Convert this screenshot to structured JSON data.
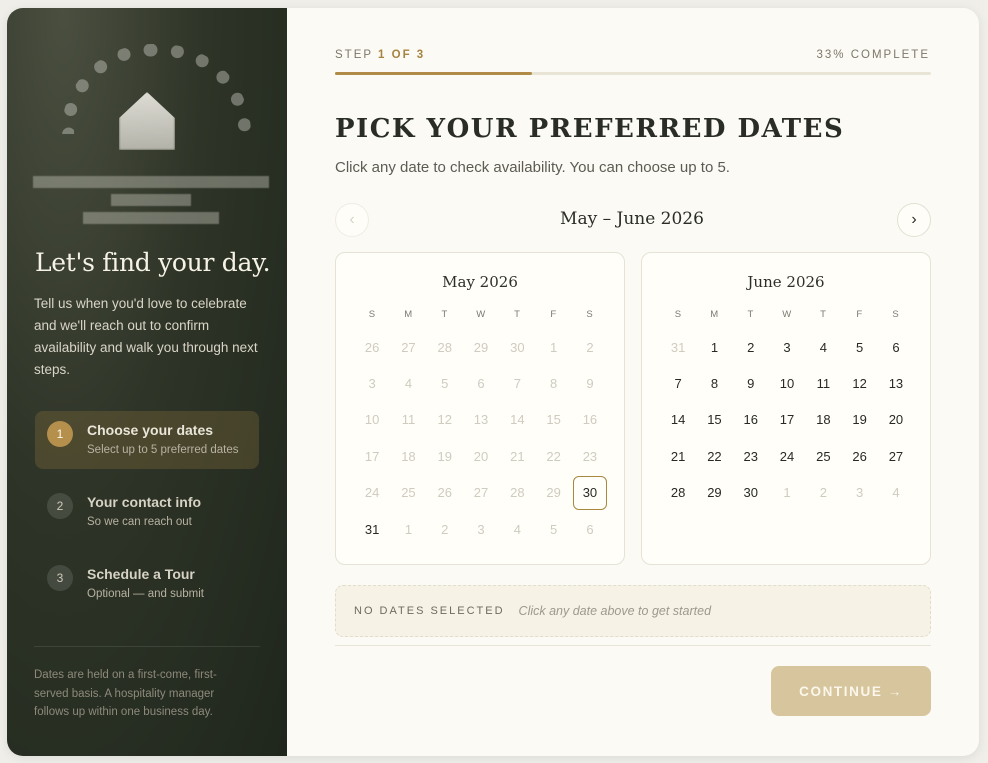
{
  "sidebar": {
    "heading": "Let's find your day.",
    "intro": "Tell us when you'd love to celebrate and we'll reach out to confirm availability and walk you through next steps.",
    "steps": [
      {
        "num": "1",
        "title": "Choose your dates",
        "subtitle": "Select up to 5 preferred dates",
        "state": "active"
      },
      {
        "num": "2",
        "title": "Your contact info",
        "subtitle": "So we can reach out",
        "state": "upcoming"
      },
      {
        "num": "3",
        "title": "Schedule a Tour",
        "subtitle": "Optional — and submit",
        "state": "upcoming"
      }
    ],
    "footnote": "Dates are held on a first-come, first-served basis. A hospitality manager follows up within one business day."
  },
  "progress": {
    "step_prefix": "STEP ",
    "step_current": "1 OF 3",
    "percent_label": "33% COMPLETE",
    "fraction": 0.33
  },
  "main": {
    "heading": "PICK YOUR PREFERRED DATES",
    "subheading": "Click any date to check availability. You can choose up to 5.",
    "range_label": "May – June 2026",
    "prev_icon": "‹",
    "next_icon": "›"
  },
  "weekdays": [
    "S",
    "M",
    "T",
    "W",
    "T",
    "F",
    "S"
  ],
  "calendars": [
    {
      "title": "May 2026",
      "days": [
        {
          "d": "26",
          "muted": true
        },
        {
          "d": "27",
          "muted": true
        },
        {
          "d": "28",
          "muted": true
        },
        {
          "d": "29",
          "muted": true
        },
        {
          "d": "30",
          "muted": true
        },
        {
          "d": "1",
          "muted": true
        },
        {
          "d": "2",
          "muted": true
        },
        {
          "d": "3",
          "muted": true
        },
        {
          "d": "4",
          "muted": true
        },
        {
          "d": "5",
          "muted": true
        },
        {
          "d": "6",
          "muted": true
        },
        {
          "d": "7",
          "muted": true
        },
        {
          "d": "8",
          "muted": true
        },
        {
          "d": "9",
          "muted": true
        },
        {
          "d": "10",
          "muted": true
        },
        {
          "d": "11",
          "muted": true
        },
        {
          "d": "12",
          "muted": true
        },
        {
          "d": "13",
          "muted": true
        },
        {
          "d": "14",
          "muted": true
        },
        {
          "d": "15",
          "muted": true
        },
        {
          "d": "16",
          "muted": true
        },
        {
          "d": "17",
          "muted": true
        },
        {
          "d": "18",
          "muted": true
        },
        {
          "d": "19",
          "muted": true
        },
        {
          "d": "20",
          "muted": true
        },
        {
          "d": "21",
          "muted": true
        },
        {
          "d": "22",
          "muted": true
        },
        {
          "d": "23",
          "muted": true
        },
        {
          "d": "24",
          "muted": true
        },
        {
          "d": "25",
          "muted": true
        },
        {
          "d": "26",
          "muted": true
        },
        {
          "d": "27",
          "muted": true
        },
        {
          "d": "28",
          "muted": true
        },
        {
          "d": "29",
          "muted": true
        },
        {
          "d": "30",
          "muted": false,
          "today": true
        },
        {
          "d": "31",
          "muted": false
        },
        {
          "d": "1",
          "muted": true
        },
        {
          "d": "2",
          "muted": true
        },
        {
          "d": "3",
          "muted": true
        },
        {
          "d": "4",
          "muted": true
        },
        {
          "d": "5",
          "muted": true
        },
        {
          "d": "6",
          "muted": true
        }
      ]
    },
    {
      "title": "June 2026",
      "days": [
        {
          "d": "31",
          "muted": true
        },
        {
          "d": "1",
          "muted": false
        },
        {
          "d": "2",
          "muted": false
        },
        {
          "d": "3",
          "muted": false
        },
        {
          "d": "4",
          "muted": false
        },
        {
          "d": "5",
          "muted": false
        },
        {
          "d": "6",
          "muted": false
        },
        {
          "d": "7",
          "muted": false
        },
        {
          "d": "8",
          "muted": false
        },
        {
          "d": "9",
          "muted": false
        },
        {
          "d": "10",
          "muted": false
        },
        {
          "d": "11",
          "muted": false
        },
        {
          "d": "12",
          "muted": false
        },
        {
          "d": "13",
          "muted": false
        },
        {
          "d": "14",
          "muted": false
        },
        {
          "d": "15",
          "muted": false
        },
        {
          "d": "16",
          "muted": false
        },
        {
          "d": "17",
          "muted": false
        },
        {
          "d": "18",
          "muted": false
        },
        {
          "d": "19",
          "muted": false
        },
        {
          "d": "20",
          "muted": false
        },
        {
          "d": "21",
          "muted": false
        },
        {
          "d": "22",
          "muted": false
        },
        {
          "d": "23",
          "muted": false
        },
        {
          "d": "24",
          "muted": false
        },
        {
          "d": "25",
          "muted": false
        },
        {
          "d": "26",
          "muted": false
        },
        {
          "d": "27",
          "muted": false
        },
        {
          "d": "28",
          "muted": false
        },
        {
          "d": "29",
          "muted": false
        },
        {
          "d": "30",
          "muted": false
        },
        {
          "d": "1",
          "muted": true
        },
        {
          "d": "2",
          "muted": true
        },
        {
          "d": "3",
          "muted": true
        },
        {
          "d": "4",
          "muted": true
        }
      ]
    }
  ],
  "selection": {
    "status": "NO DATES SELECTED",
    "hint": "Click any date above to get started"
  },
  "actions": {
    "continue_label": "CONTINUE →"
  },
  "colors": {
    "accent": "#b18c46",
    "sidebar_bg": "#2e3427",
    "continue_bg": "#d7c59d"
  }
}
